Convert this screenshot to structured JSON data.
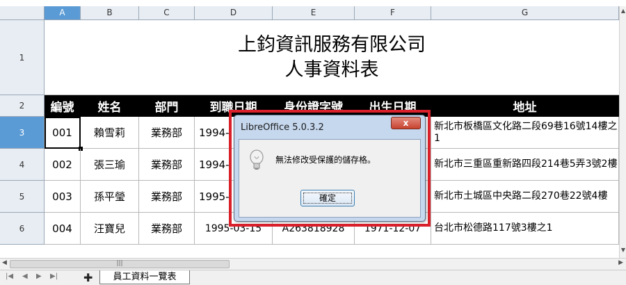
{
  "columns": [
    "A",
    "B",
    "C",
    "D",
    "E",
    "F",
    "G"
  ],
  "rows": [
    "1",
    "2",
    "3",
    "4",
    "5",
    "6"
  ],
  "title_line1": "上鈞資訊服務有限公司",
  "title_line2": "人事資料表",
  "headers": [
    "編號",
    "姓名",
    "部門",
    "到職日期",
    "身份證字號",
    "出生日期",
    "地址"
  ],
  "data": [
    {
      "id": "001",
      "name": "賴雪莉",
      "dept": "業務部",
      "date": "1994-",
      "idno": "",
      "birth": "",
      "addr": "新北市板橋區文化路二段69巷16號14樓之1"
    },
    {
      "id": "002",
      "name": "張三瑜",
      "dept": "業務部",
      "date": "1994-",
      "idno": "",
      "birth": "",
      "addr": "新北市三重區重新路四段214巷5弄3號2樓"
    },
    {
      "id": "003",
      "name": "孫平瑩",
      "dept": "業務部",
      "date": "1995-",
      "idno": "",
      "birth": "",
      "addr": "新北市土城區中央路二段270巷22號4樓"
    },
    {
      "id": "004",
      "name": "汪寶兒",
      "dept": "業務部",
      "date": "1995-03-15",
      "idno": "A263818928",
      "birth": "1971-12-07",
      "addr": "台北市松德路117號3樓之1"
    }
  ],
  "sheet_tab": "員工資料一覽表",
  "dialog": {
    "title": "LibreOffice 5.0.3.2",
    "close": "x",
    "message": "無法修改受保護的儲存格。",
    "ok": "確定"
  },
  "icons": {
    "dialog": "lightbulb-icon",
    "add_sheet": "plus-icon"
  },
  "colors": {
    "header_bg": "#000000",
    "header_fg": "#ffffff",
    "selected_header": "#5b9bd5",
    "dialog_highlight": "#d9202b"
  }
}
